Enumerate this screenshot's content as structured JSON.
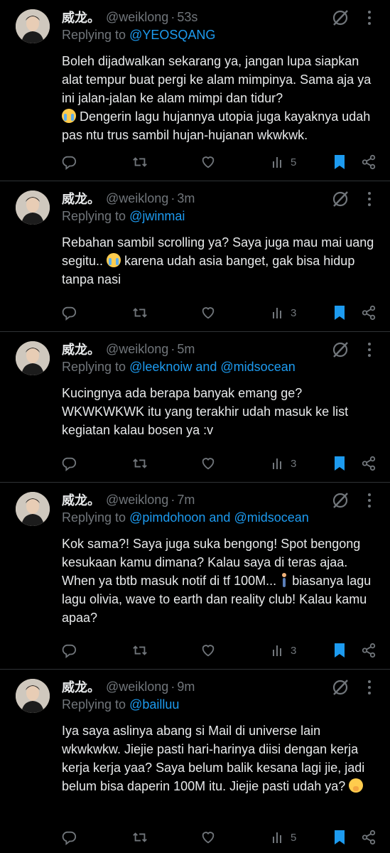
{
  "colors": {
    "background": "#000000",
    "text": "#e7e9ea",
    "muted": "#71767b",
    "link": "#1d9bf0",
    "divider": "#2f3336",
    "bookmark": "#1d9bf0"
  },
  "tweets": [
    {
      "name": "威龙。",
      "handle": "@weiklong",
      "dot": "·",
      "time": "53s",
      "reply_prefix": "Replying to ",
      "reply_to": "@YEOSQANG",
      "text_parts": [
        "Boleh dijadwalkan sekarang ya, jangan lupa siapkan alat tempur buat pergi ke alam mimpinya. Sama aja ya ini jalan-jalan ke alam mimpi dan tidur?",
        "Dengerin lagu hujannya utopia juga kayaknya udah pas ntu trus sambil hujan-hujanan wkwkwk."
      ],
      "emoji": "loudly-crying-face",
      "views": "5",
      "bookmarked": true
    },
    {
      "name": "威龙。",
      "handle": "@weiklong",
      "dot": "·",
      "time": "3m",
      "reply_prefix": "Replying to ",
      "reply_to": "@jwinmai",
      "text_parts": [
        "Rebahan sambil scrolling ya? Saya juga mau mai uang segitu..",
        "karena udah asia banget, gak bisa hidup tanpa nasi"
      ],
      "emoji": "loudly-crying-face",
      "views": "3",
      "bookmarked": true
    },
    {
      "name": "威龙。",
      "handle": "@weiklong",
      "dot": "·",
      "time": "5m",
      "reply_prefix": "Replying to ",
      "reply_to": "@leeknoiw and @midsocean",
      "text_parts": [
        "Kucingnya ada berapa banyak emang ge? WKWKWKWK itu yang terakhir udah masuk ke list kegiatan kalau bosen ya :v"
      ],
      "emoji": "",
      "views": "3",
      "bookmarked": true
    },
    {
      "name": "威龙。",
      "handle": "@weiklong",
      "dot": "·",
      "time": "7m",
      "reply_prefix": "Replying to ",
      "reply_to": "@pimdohoon and @midsocean",
      "text_parts": [
        "Kok sama?! Saya juga suka bengong! Spot bengong kesukaan kamu dimana? Kalau saya di teras ajaa. When ya tbtb masuk notif di tf 100M...",
        "biasanya lagu lagu olivia, wave to earth dan reality club! Kalau kamu apaa?"
      ],
      "emoji": "person-walking",
      "views": "3",
      "bookmarked": true
    },
    {
      "name": "威龙。",
      "handle": "@weiklong",
      "dot": "·",
      "time": "9m",
      "reply_prefix": "Replying to ",
      "reply_to": "@bailluu",
      "text_parts": [
        "Iya saya aslinya abang si Mail di universe lain wkwkwkw. Jiejie pasti hari-harinya diisi dengan kerja kerja kerja yaa? Saya belum balik kesana lagi jie, jadi belum bisa daperin 100M itu. Jiejie pasti udah ya?"
      ],
      "emoji": "face-with-hand-over-mouth",
      "views": "5",
      "bookmarked": true
    }
  ],
  "icons": {
    "reply": "reply-icon",
    "retweet": "retweet-icon",
    "like": "heart-icon",
    "views": "views-icon",
    "bookmark": "bookmark-icon",
    "share": "share-icon",
    "grok": "grok-icon",
    "more": "more-icon"
  }
}
